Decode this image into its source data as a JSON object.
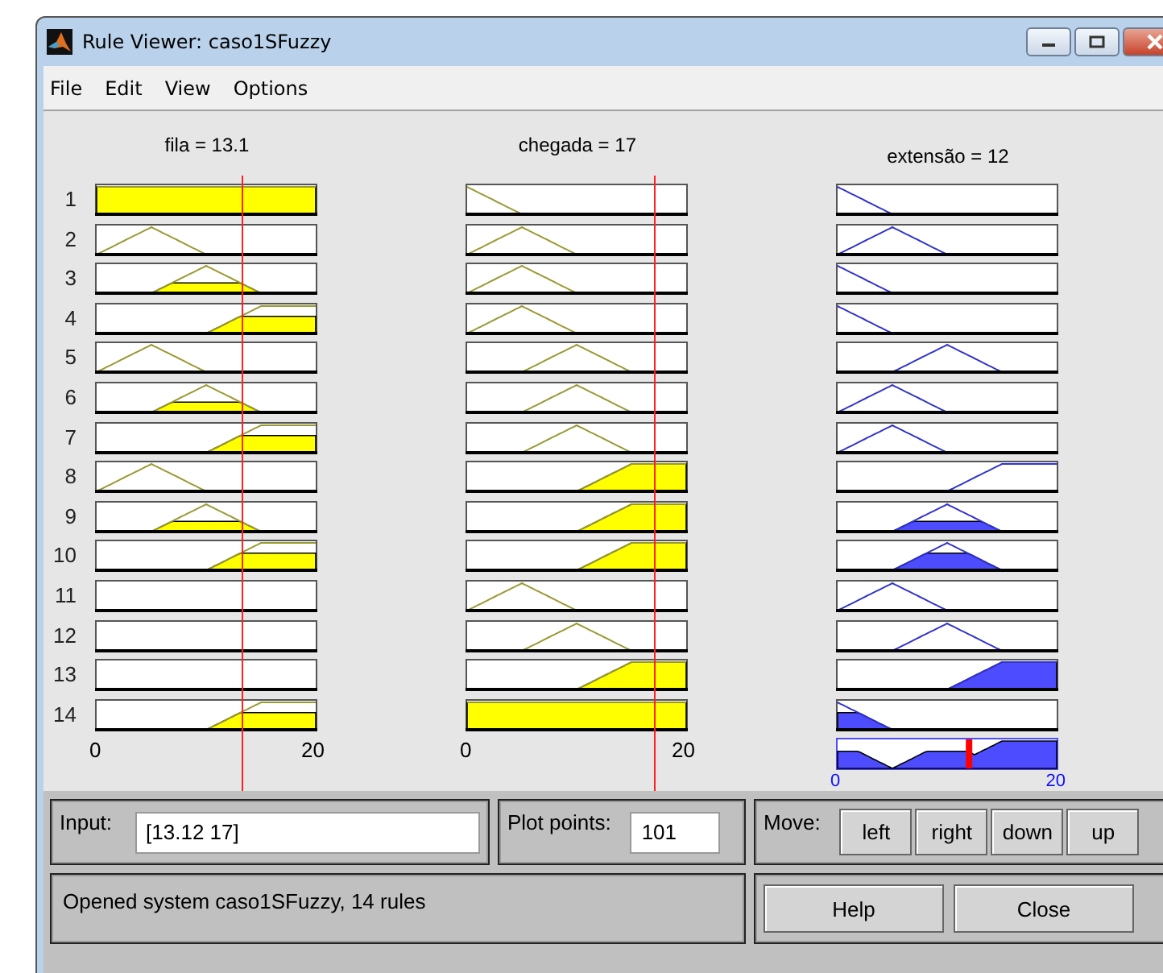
{
  "window": {
    "title": "Rule Viewer: caso1SFuzzy"
  },
  "menu": [
    "File",
    "Edit",
    "View",
    "Options"
  ],
  "variables": [
    {
      "label": "fila = 13.1",
      "kind": "input",
      "tick_min": "0",
      "tick_max": "20"
    },
    {
      "label": "chegada = 17",
      "kind": "input",
      "tick_min": "0",
      "tick_max": "20"
    },
    {
      "label": "extensão = 12",
      "kind": "output",
      "tick_min": "0",
      "tick_max": "20"
    }
  ],
  "rules": [
    {
      "number": "1",
      "cells": [
        {
          "kind": "full"
        },
        {
          "kind": "zero"
        },
        {
          "kind": "zero"
        }
      ]
    },
    {
      "number": "2",
      "cells": [
        {
          "kind": "low"
        },
        {
          "kind": "low"
        },
        {
          "kind": "low"
        }
      ]
    },
    {
      "number": "3",
      "cells": [
        {
          "kind": "mid"
        },
        {
          "kind": "low"
        },
        {
          "kind": "zero"
        }
      ]
    },
    {
      "number": "4",
      "cells": [
        {
          "kind": "high"
        },
        {
          "kind": "low"
        },
        {
          "kind": "zero"
        }
      ]
    },
    {
      "number": "5",
      "cells": [
        {
          "kind": "low"
        },
        {
          "kind": "mid"
        },
        {
          "kind": "mid"
        }
      ]
    },
    {
      "number": "6",
      "cells": [
        {
          "kind": "mid"
        },
        {
          "kind": "mid"
        },
        {
          "kind": "low"
        }
      ]
    },
    {
      "number": "7",
      "cells": [
        {
          "kind": "high"
        },
        {
          "kind": "mid"
        },
        {
          "kind": "low"
        }
      ]
    },
    {
      "number": "8",
      "cells": [
        {
          "kind": "low"
        },
        {
          "kind": "high"
        },
        {
          "kind": "high"
        }
      ]
    },
    {
      "number": "9",
      "cells": [
        {
          "kind": "mid"
        },
        {
          "kind": "high"
        },
        {
          "kind": "mid"
        }
      ]
    },
    {
      "number": "10",
      "cells": [
        {
          "kind": "high"
        },
        {
          "kind": "high"
        },
        {
          "kind": "mid"
        }
      ]
    },
    {
      "number": "11",
      "cells": [
        {
          "kind": "empty"
        },
        {
          "kind": "low"
        },
        {
          "kind": "low"
        }
      ]
    },
    {
      "number": "12",
      "cells": [
        {
          "kind": "empty"
        },
        {
          "kind": "mid"
        },
        {
          "kind": "mid"
        }
      ]
    },
    {
      "number": "13",
      "cells": [
        {
          "kind": "empty"
        },
        {
          "kind": "high"
        },
        {
          "kind": "high"
        }
      ]
    },
    {
      "number": "14",
      "cells": [
        {
          "kind": "high"
        },
        {
          "kind": "full"
        },
        {
          "kind": "zero"
        }
      ]
    }
  ],
  "input_panel": {
    "label": "Input:",
    "value": "[13.12 17]"
  },
  "plot_points": {
    "label": "Plot points:",
    "value": "101"
  },
  "move": {
    "label": "Move:",
    "buttons": [
      "left",
      "right",
      "down",
      "up"
    ]
  },
  "status": "Opened system caso1SFuzzy, 14 rules",
  "buttons": [
    "Help",
    "Close"
  ]
}
